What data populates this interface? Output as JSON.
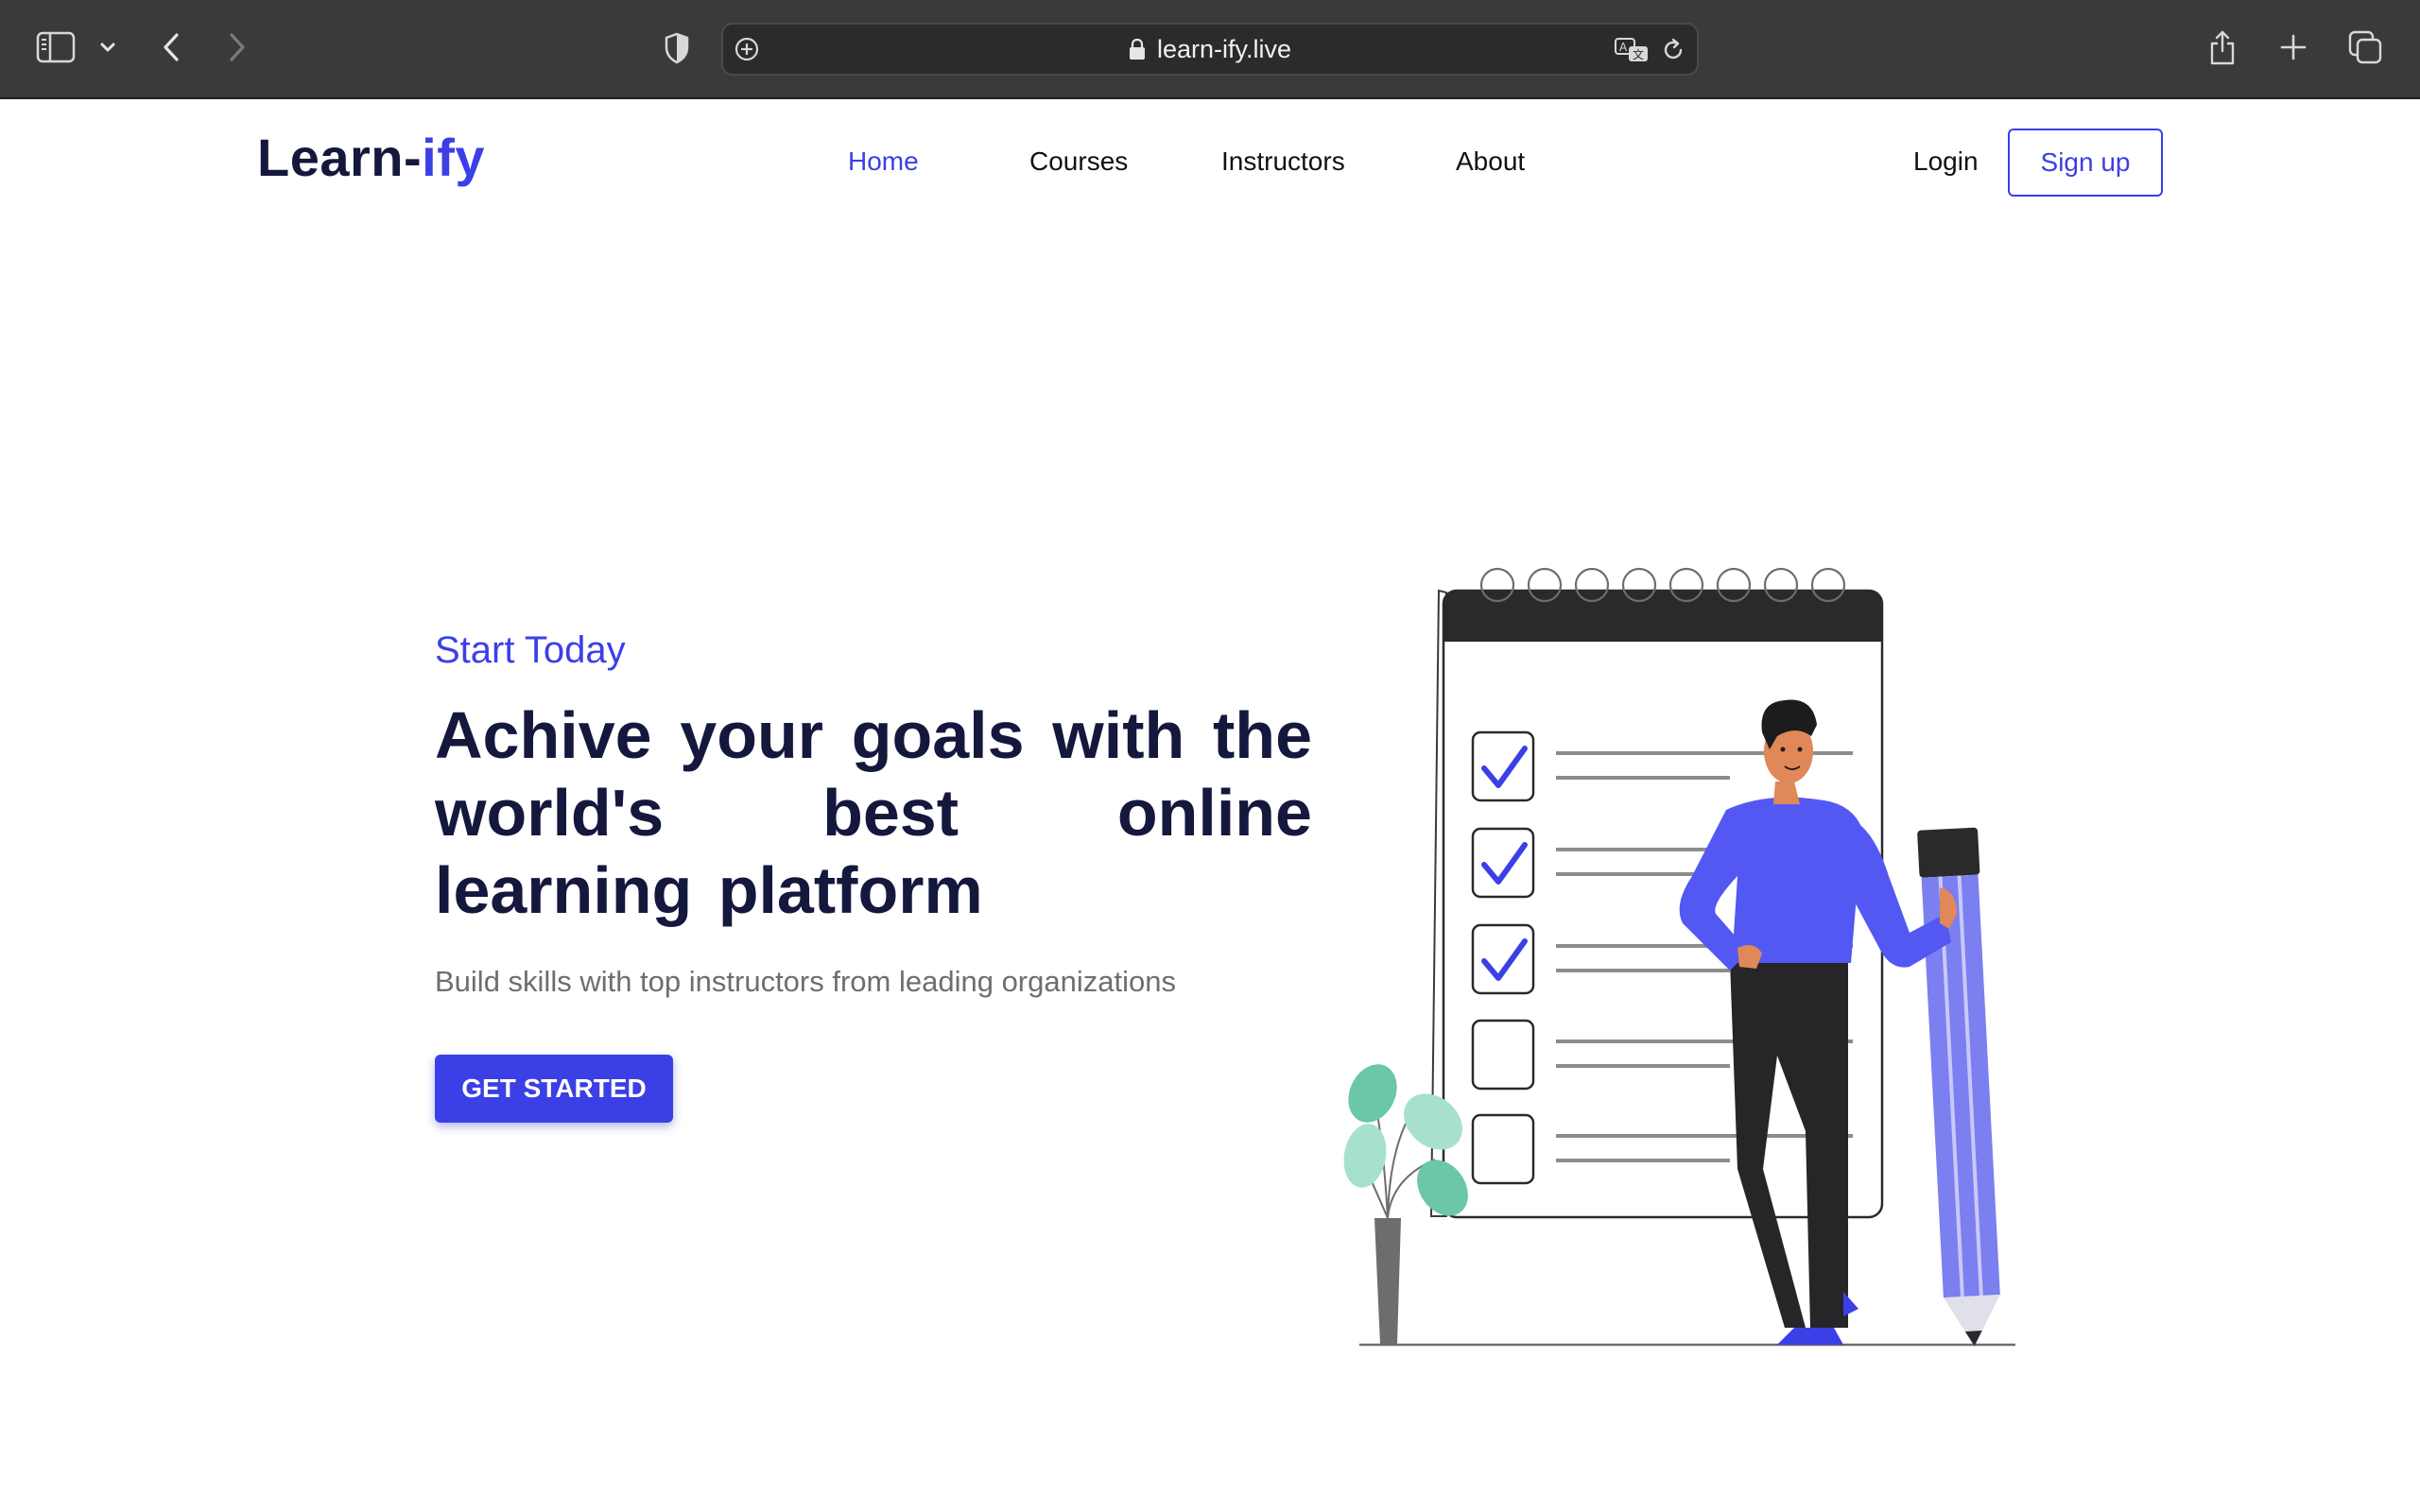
{
  "browser": {
    "url": "learn-ify.live"
  },
  "site": {
    "logo_main": "Learn-",
    "logo_accent": "ify",
    "nav": {
      "home": "Home",
      "courses": "Courses",
      "instructors": "Instructors",
      "about": "About"
    },
    "login": "Login",
    "signup": "Sign up"
  },
  "hero": {
    "eyebrow": "Start Today",
    "title": "Achive your goals with the world's best online learning platform",
    "subtitle": "Build skills with top instructors from leading organizations",
    "cta": "GET STARTED"
  },
  "colors": {
    "accent": "#3b3fe6",
    "heading": "#14183d",
    "muted": "#6e6e6e",
    "chrome": "#3a3a3c",
    "leaf": "#7fd1b9"
  },
  "icons": {
    "sidebar": "sidebar-icon",
    "back": "chevron-left-icon",
    "forward": "chevron-right-icon",
    "privacy": "shield-icon",
    "lock": "lock-icon",
    "translate": "translate-icon",
    "reload": "reload-icon",
    "share": "share-icon",
    "new_tab": "plus-icon",
    "tabs": "tabs-overview-icon"
  }
}
